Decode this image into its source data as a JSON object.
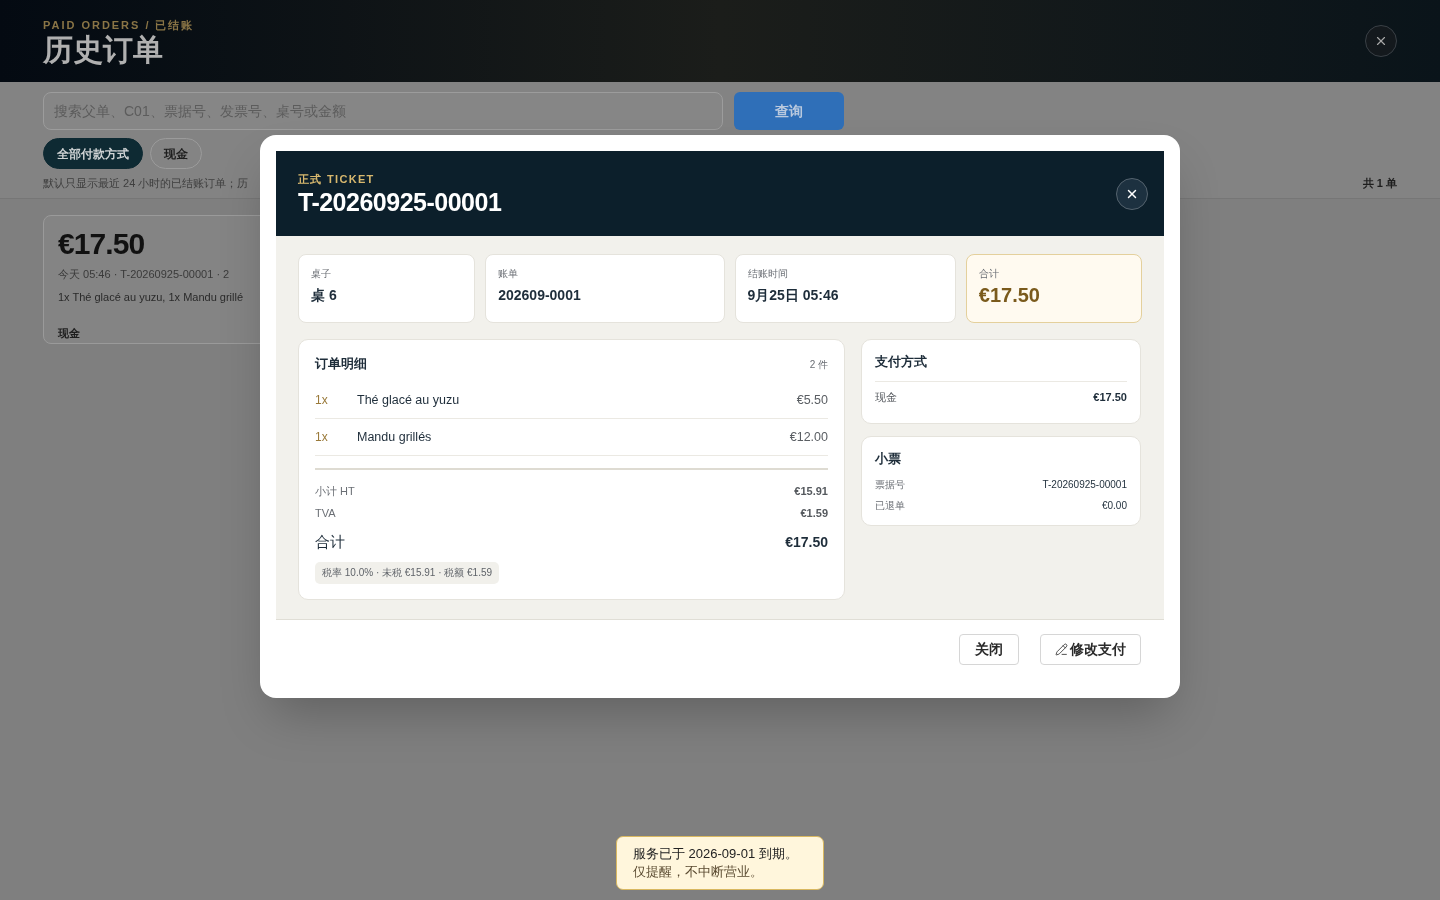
{
  "page": {
    "eyebrow": "PAID ORDERS / 已结账",
    "title": "历史订单"
  },
  "search": {
    "placeholder": "搜索父单、C01、票据号、发票号、桌号或金额",
    "button": "查询"
  },
  "filters": [
    {
      "label": "全部付款方式",
      "selected": true
    },
    {
      "label": "现金",
      "selected": false
    }
  ],
  "hint": "默认只显示最近 24 小时的已结账订单；历",
  "count": "共 1 单",
  "orders": [
    {
      "total": "€17.50",
      "meta": "今天 05:46 · T-20260925-00001 · 2",
      "items": "1x Thé glacé au yuzu, 1x Mandu grillé",
      "payment": "现金"
    }
  ],
  "dialog": {
    "eyebrow": "正式 TICKET",
    "title": "T-20260925-00001",
    "summary": [
      {
        "label": "桌子",
        "value": "桌 6",
        "kind": "plain"
      },
      {
        "label": "账单",
        "value": "202609-0001",
        "kind": "plain"
      },
      {
        "label": "结账时间",
        "value": "9月25日 05:46",
        "kind": "plain"
      },
      {
        "label": "合计",
        "value": "€17.50",
        "kind": "highlight"
      }
    ],
    "details": {
      "title": "订单明细",
      "count": "2 件",
      "lines": [
        {
          "qty": "1x",
          "name": "Thé glacé au yuzu",
          "price": "€5.50"
        },
        {
          "qty": "1x",
          "name": "Mandu grillés",
          "price": "€12.00"
        }
      ],
      "totals": [
        {
          "label": "小计 HT",
          "value": "€15.91",
          "kind": "sub"
        },
        {
          "label": "TVA",
          "value": "€1.59",
          "kind": "sub"
        },
        {
          "label": "合计",
          "value": "€17.50",
          "kind": "grand"
        }
      ],
      "tax_note": "税率 10.0% · 未税 €15.91 · 税额 €1.59"
    },
    "payments": {
      "title": "支付方式",
      "rows": [
        {
          "method": "现金",
          "amount": "€17.50"
        }
      ]
    },
    "receipt": {
      "title": "小票",
      "rows": [
        {
          "label": "票据号",
          "value": "T-20260925-00001"
        },
        {
          "label": "已退单",
          "value": "€0.00"
        }
      ]
    },
    "buttons": [
      {
        "label": "关闭",
        "kind": "plain"
      },
      {
        "label": "修改支付",
        "kind": "edit"
      }
    ]
  },
  "toast": {
    "lines": [
      "服务已于 2026-09-01 到期。",
      "仅提醒，不中断营业。"
    ]
  }
}
